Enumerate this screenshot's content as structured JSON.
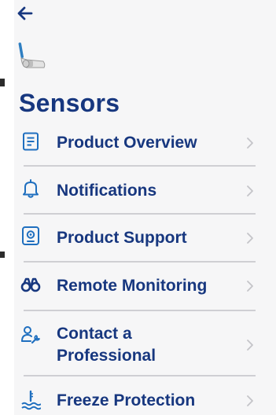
{
  "header": {
    "back_icon": "arrow-left-icon",
    "product_image": "sensor-product-image"
  },
  "page": {
    "title": "Sensors"
  },
  "menu": {
    "items": [
      {
        "label": "Product Overview",
        "icon": "document-list-icon"
      },
      {
        "label": "Notifications",
        "icon": "bell-icon"
      },
      {
        "label": "Product Support",
        "icon": "tablet-gear-icon"
      },
      {
        "label": "Remote Monitoring",
        "icon": "binoculars-icon"
      },
      {
        "label_line1": "Contact a",
        "label_line2": "Professional",
        "icon": "person-wrench-icon"
      },
      {
        "label": "Freeze Protection",
        "icon": "water-temperature-icon"
      }
    ],
    "chevron_icon": "chevron-right-icon"
  },
  "colors": {
    "brand": "#17377f",
    "accent": "#1f6fbf",
    "chevron": "#c4c4c8",
    "divider": "#cfcfd3",
    "panel_background": "#f6f6f7"
  }
}
